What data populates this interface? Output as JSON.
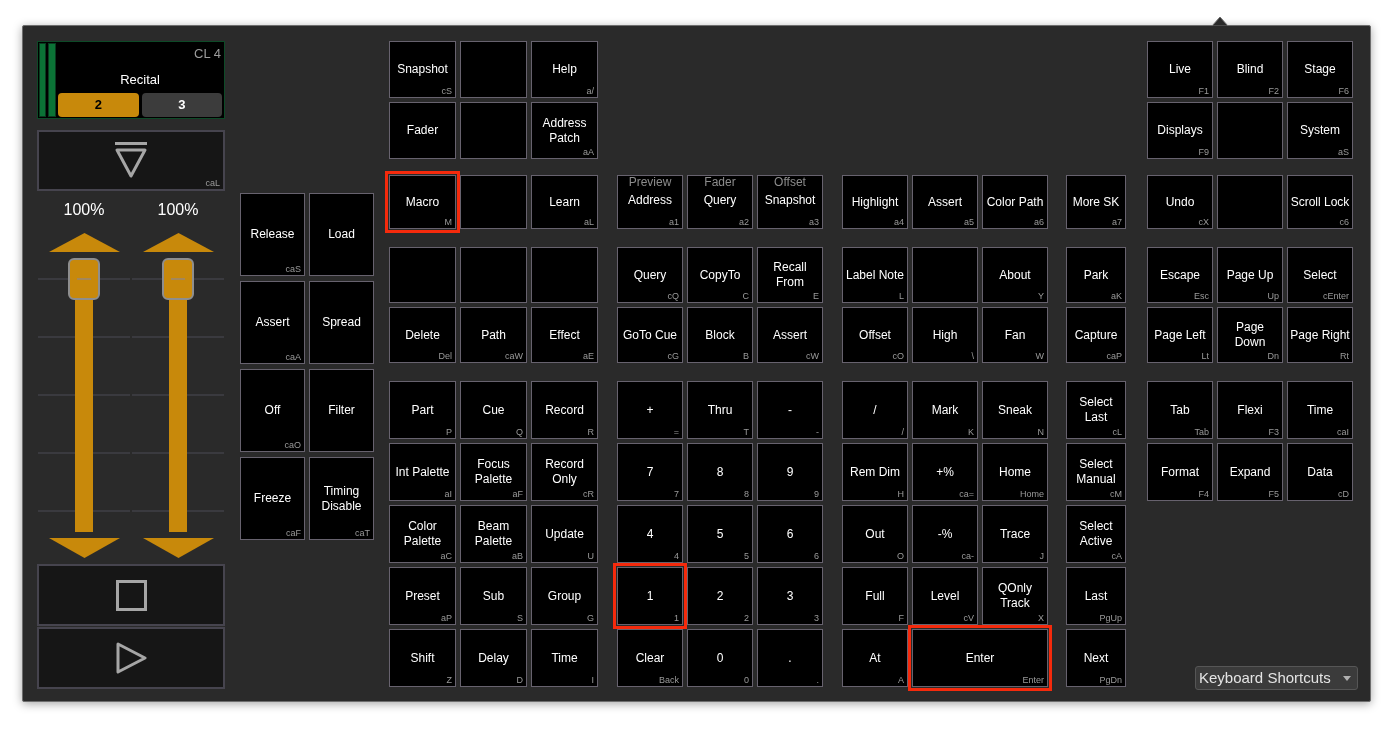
{
  "cue_list": {
    "label": "CL 4",
    "name": "Recital",
    "cues": [
      {
        "label": "2",
        "selected": true
      },
      {
        "label": "3",
        "selected": false
      }
    ]
  },
  "fader_top_button": {
    "shortcut": "caL"
  },
  "faders": [
    {
      "reading": "100%",
      "level": 1
    },
    {
      "reading": "100%",
      "level": 1
    }
  ],
  "side_keys": [
    [
      {
        "kind": "key",
        "label": "Release",
        "shortcut": "caS",
        "highlighted": false
      },
      {
        "kind": "key",
        "label": "Load",
        "highlighted": false
      }
    ],
    [
      {
        "kind": "key",
        "label": "Assert",
        "shortcut": "caA",
        "highlighted": false
      },
      {
        "kind": "key",
        "label": "Spread",
        "highlighted": false
      }
    ],
    [
      {
        "kind": "key",
        "label": "Off",
        "shortcut": "caO",
        "highlighted": false
      },
      {
        "kind": "key",
        "label": "Filter",
        "highlighted": false
      }
    ],
    [
      {
        "kind": "key",
        "label": "Freeze",
        "shortcut": "caF",
        "highlighted": false
      },
      {
        "kind": "key",
        "label": "Timing Disable",
        "shortcut": "caT",
        "highlighted": false
      }
    ]
  ],
  "key_groups": [
    {
      "sections": [
        {
          "rows": [
            [
              {
                "kind": "key",
                "label": "Snapshot",
                "shortcut": "cS",
                "highlighted": false
              },
              {
                "kind": "blank",
                "highlighted": false
              },
              {
                "kind": "key",
                "label": "Help",
                "shortcut": "a/",
                "highlighted": false
              }
            ],
            [
              {
                "kind": "key",
                "label": "Fader",
                "highlighted": false
              },
              {
                "kind": "blank",
                "highlighted": false
              },
              {
                "kind": "key",
                "label": "Address Patch",
                "shortcut": "aA",
                "highlighted": false
              }
            ]
          ]
        },
        {
          "rows": [
            [
              {
                "kind": "key",
                "label": "Macro",
                "shortcut": "M",
                "highlighted": true
              },
              {
                "kind": "blank",
                "highlighted": false
              },
              {
                "kind": "key",
                "label": "Learn",
                "shortcut": "aL",
                "highlighted": false
              }
            ]
          ]
        },
        {
          "rows": [
            [
              {
                "kind": "blank",
                "highlighted": false
              },
              {
                "kind": "blank",
                "highlighted": false
              },
              {
                "kind": "blank",
                "highlighted": false
              }
            ],
            [
              {
                "kind": "key",
                "label": "Delete",
                "shortcut": "Del",
                "highlighted": false
              },
              {
                "kind": "key",
                "label": "Path",
                "shortcut": "caW",
                "highlighted": false
              },
              {
                "kind": "key",
                "label": "Effect",
                "shortcut": "aE",
                "highlighted": false
              }
            ]
          ]
        },
        {
          "rows": [
            [
              {
                "kind": "key",
                "label": "Part",
                "shortcut": "P",
                "highlighted": false
              },
              {
                "kind": "key",
                "label": "Cue",
                "shortcut": "Q",
                "highlighted": false
              },
              {
                "kind": "key",
                "label": "Record",
                "shortcut": "R",
                "highlighted": false
              }
            ],
            [
              {
                "kind": "key",
                "label": "Int Palette",
                "shortcut": "aI",
                "highlighted": false
              },
              {
                "kind": "key",
                "label": "Focus Palette",
                "shortcut": "aF",
                "highlighted": false
              },
              {
                "kind": "key",
                "label": "Record Only",
                "shortcut": "cR",
                "highlighted": false
              }
            ],
            [
              {
                "kind": "key",
                "label": "Color Palette",
                "shortcut": "aC",
                "highlighted": false
              },
              {
                "kind": "key",
                "label": "Beam Palette",
                "shortcut": "aB",
                "highlighted": false
              },
              {
                "kind": "key",
                "label": "Update",
                "shortcut": "U",
                "highlighted": false
              }
            ],
            [
              {
                "kind": "key",
                "label": "Preset",
                "shortcut": "aP",
                "highlighted": false
              },
              {
                "kind": "key",
                "label": "Sub",
                "shortcut": "S",
                "highlighted": false
              },
              {
                "kind": "key",
                "label": "Group",
                "shortcut": "G",
                "highlighted": false
              }
            ],
            [
              {
                "kind": "key",
                "label": "Shift",
                "shortcut": "Z",
                "highlighted": false
              },
              {
                "kind": "key",
                "label": "Delay",
                "shortcut": "D",
                "highlighted": false
              },
              {
                "kind": "key",
                "label": "Time",
                "shortcut": "I",
                "highlighted": false
              }
            ]
          ]
        }
      ]
    },
    {
      "sections": [
        {
          "rows": [
            [
              {
                "kind": "key",
                "caption": "Preview",
                "label": "Address",
                "shortcut": "a1",
                "highlighted": false
              },
              {
                "kind": "key",
                "caption": "Fader",
                "label": "Query",
                "shortcut": "a2",
                "highlighted": false
              },
              {
                "kind": "key",
                "caption": "Offset",
                "label": "Snapshot",
                "shortcut": "a3",
                "highlighted": false
              }
            ]
          ]
        },
        {
          "rows": [
            [
              {
                "kind": "key",
                "label": "Query",
                "shortcut": "cQ",
                "highlighted": false
              },
              {
                "kind": "key",
                "label": "CopyTo",
                "shortcut": "C",
                "highlighted": false
              },
              {
                "kind": "key",
                "label": "Recall From",
                "shortcut": "E",
                "highlighted": false
              }
            ],
            [
              {
                "kind": "key",
                "label": "GoTo Cue",
                "shortcut": "cG",
                "highlighted": false
              },
              {
                "kind": "key",
                "label": "Block",
                "shortcut": "B",
                "highlighted": false
              },
              {
                "kind": "key",
                "label": "Assert",
                "shortcut": "cW",
                "highlighted": false
              }
            ]
          ]
        },
        {
          "rows": [
            [
              {
                "kind": "key",
                "label": "+",
                "shortcut": "=",
                "highlighted": false
              },
              {
                "kind": "key",
                "label": "Thru",
                "shortcut": "T",
                "highlighted": false
              },
              {
                "kind": "key",
                "label": "-",
                "shortcut": "-",
                "highlighted": false
              }
            ],
            [
              {
                "kind": "key",
                "label": "7",
                "shortcut": "7",
                "highlighted": false
              },
              {
                "kind": "key",
                "label": "8",
                "shortcut": "8",
                "highlighted": false
              },
              {
                "kind": "key",
                "label": "9",
                "shortcut": "9",
                "highlighted": false
              }
            ],
            [
              {
                "kind": "key",
                "label": "4",
                "shortcut": "4",
                "highlighted": false
              },
              {
                "kind": "key",
                "label": "5",
                "shortcut": "5",
                "highlighted": false
              },
              {
                "kind": "key",
                "label": "6",
                "shortcut": "6",
                "highlighted": false
              }
            ],
            [
              {
                "kind": "key",
                "label": "1",
                "shortcut": "1",
                "highlighted": true
              },
              {
                "kind": "key",
                "label": "2",
                "shortcut": "2",
                "highlighted": false
              },
              {
                "kind": "key",
                "label": "3",
                "shortcut": "3",
                "highlighted": false
              }
            ],
            [
              {
                "kind": "key",
                "label": "Clear",
                "shortcut": "Back",
                "highlighted": false
              },
              {
                "kind": "key",
                "label": "0",
                "shortcut": "0",
                "highlighted": false
              },
              {
                "kind": "key",
                "label": ".",
                "shortcut": ".",
                "highlighted": false
              }
            ]
          ]
        }
      ]
    },
    {
      "sections": [
        {
          "rows": [
            [
              {
                "kind": "key",
                "label": "Highlight",
                "shortcut": "a4",
                "highlighted": false
              },
              {
                "kind": "key",
                "label": "Assert",
                "shortcut": "a5",
                "highlighted": false
              },
              {
                "kind": "key",
                "label": "Color Path",
                "shortcut": "a6",
                "highlighted": false
              }
            ]
          ]
        },
        {
          "rows": [
            [
              {
                "kind": "key",
                "label": "Label Note",
                "shortcut": "L",
                "highlighted": false
              },
              {
                "kind": "blank",
                "highlighted": false
              },
              {
                "kind": "key",
                "label": "About",
                "shortcut": "Y",
                "highlighted": false
              }
            ],
            [
              {
                "kind": "key",
                "label": "Offset",
                "shortcut": "cO",
                "highlighted": false
              },
              {
                "kind": "key",
                "label": "High",
                "shortcut": "\\",
                "highlighted": false
              },
              {
                "kind": "key",
                "label": "Fan",
                "shortcut": "W",
                "highlighted": false
              }
            ]
          ]
        },
        {
          "rows": [
            [
              {
                "kind": "key",
                "label": "/",
                "shortcut": "/",
                "highlighted": false
              },
              {
                "kind": "key",
                "label": "Mark",
                "shortcut": "K",
                "highlighted": false
              },
              {
                "kind": "key",
                "label": "Sneak",
                "shortcut": "N",
                "highlighted": false
              }
            ],
            [
              {
                "kind": "key",
                "label": "Rem Dim",
                "shortcut": "H",
                "highlighted": false
              },
              {
                "kind": "key",
                "label": "+%",
                "shortcut": "ca=",
                "highlighted": false
              },
              {
                "kind": "key",
                "label": "Home",
                "shortcut": "Home",
                "highlighted": false
              }
            ],
            [
              {
                "kind": "key",
                "label": "Out",
                "shortcut": "O",
                "highlighted": false
              },
              {
                "kind": "key",
                "label": "-%",
                "shortcut": "ca-",
                "highlighted": false
              },
              {
                "kind": "key",
                "label": "Trace",
                "shortcut": "J",
                "highlighted": false
              }
            ],
            [
              {
                "kind": "key",
                "label": "Full",
                "shortcut": "F",
                "highlighted": false
              },
              {
                "kind": "key",
                "label": "Level",
                "shortcut": "cV",
                "highlighted": false
              },
              {
                "kind": "key",
                "label": "QOnly Track",
                "shortcut": "X",
                "highlighted": false
              }
            ],
            [
              {
                "kind": "key",
                "label": "At",
                "shortcut": "A",
                "highlighted": false
              },
              {
                "kind": "wide",
                "label": "Enter",
                "shortcut": "Enter",
                "highlighted": true
              }
            ]
          ]
        }
      ]
    },
    {
      "sections": [
        {
          "rows": [
            [
              {
                "kind": "key",
                "label": "More SK",
                "shortcut": "a7",
                "highlighted": false
              }
            ]
          ]
        },
        {
          "rows": [
            [
              {
                "kind": "key",
                "label": "Park",
                "shortcut": "aK",
                "highlighted": false
              }
            ],
            [
              {
                "kind": "key",
                "label": "Capture",
                "shortcut": "caP",
                "highlighted": false
              }
            ]
          ]
        },
        {
          "rows": [
            [
              {
                "kind": "key",
                "label": "Select Last",
                "shortcut": "cL",
                "highlighted": false
              }
            ],
            [
              {
                "kind": "key",
                "label": "Select Manual",
                "shortcut": "cM",
                "highlighted": false
              }
            ],
            [
              {
                "kind": "key",
                "label": "Select Active",
                "shortcut": "cA",
                "highlighted": false
              }
            ],
            [
              {
                "kind": "key",
                "label": "Last",
                "shortcut": "PgUp",
                "highlighted": false
              }
            ],
            [
              {
                "kind": "key",
                "label": "Next",
                "shortcut": "PgDn",
                "highlighted": false
              }
            ]
          ]
        }
      ]
    },
    {
      "sections": [
        {
          "rows": [
            [
              {
                "kind": "key",
                "label": "Live",
                "shortcut": "F1",
                "highlighted": false
              },
              {
                "kind": "key",
                "label": "Blind",
                "shortcut": "F2",
                "highlighted": false
              },
              {
                "kind": "key",
                "label": "Stage",
                "shortcut": "F6",
                "highlighted": false
              }
            ],
            [
              {
                "kind": "key",
                "label": "Displays",
                "shortcut": "F9",
                "highlighted": false
              },
              {
                "kind": "blank",
                "highlighted": false
              },
              {
                "kind": "key",
                "label": "System",
                "shortcut": "aS",
                "highlighted": false
              }
            ]
          ]
        },
        {
          "rows": [
            [
              {
                "kind": "key",
                "label": "Undo",
                "shortcut": "cX",
                "highlighted": false
              },
              {
                "kind": "blank",
                "highlighted": false
              },
              {
                "kind": "key",
                "label": "Scroll Lock",
                "shortcut": "c6",
                "highlighted": false
              }
            ]
          ]
        },
        {
          "rows": [
            [
              {
                "kind": "key",
                "label": "Escape",
                "shortcut": "Esc",
                "highlighted": false
              },
              {
                "kind": "key",
                "label": "Page Up",
                "shortcut": "Up",
                "highlighted": false
              },
              {
                "kind": "key",
                "label": "Select",
                "shortcut": "cEnter",
                "highlighted": false
              }
            ],
            [
              {
                "kind": "key",
                "label": "Page Left",
                "shortcut": "Lt",
                "highlighted": false
              },
              {
                "kind": "key",
                "label": "Page Down",
                "shortcut": "Dn",
                "highlighted": false
              },
              {
                "kind": "key",
                "label": "Page Right",
                "shortcut": "Rt",
                "highlighted": false
              }
            ]
          ]
        },
        {
          "rows": [
            [
              {
                "kind": "key",
                "label": "Tab",
                "shortcut": "Tab",
                "highlighted": false
              },
              {
                "kind": "key",
                "label": "Flexi",
                "shortcut": "F3",
                "highlighted": false
              },
              {
                "kind": "key",
                "label": "Time",
                "shortcut": "caI",
                "highlighted": false
              }
            ],
            [
              {
                "kind": "key",
                "label": "Format",
                "shortcut": "F4",
                "highlighted": false
              },
              {
                "kind": "key",
                "label": "Expand",
                "shortcut": "F5",
                "highlighted": false
              },
              {
                "kind": "key",
                "label": "Data",
                "shortcut": "cD",
                "highlighted": false
              }
            ]
          ]
        }
      ]
    }
  ],
  "dropdown": {
    "value": "Keyboard Shortcuts"
  }
}
